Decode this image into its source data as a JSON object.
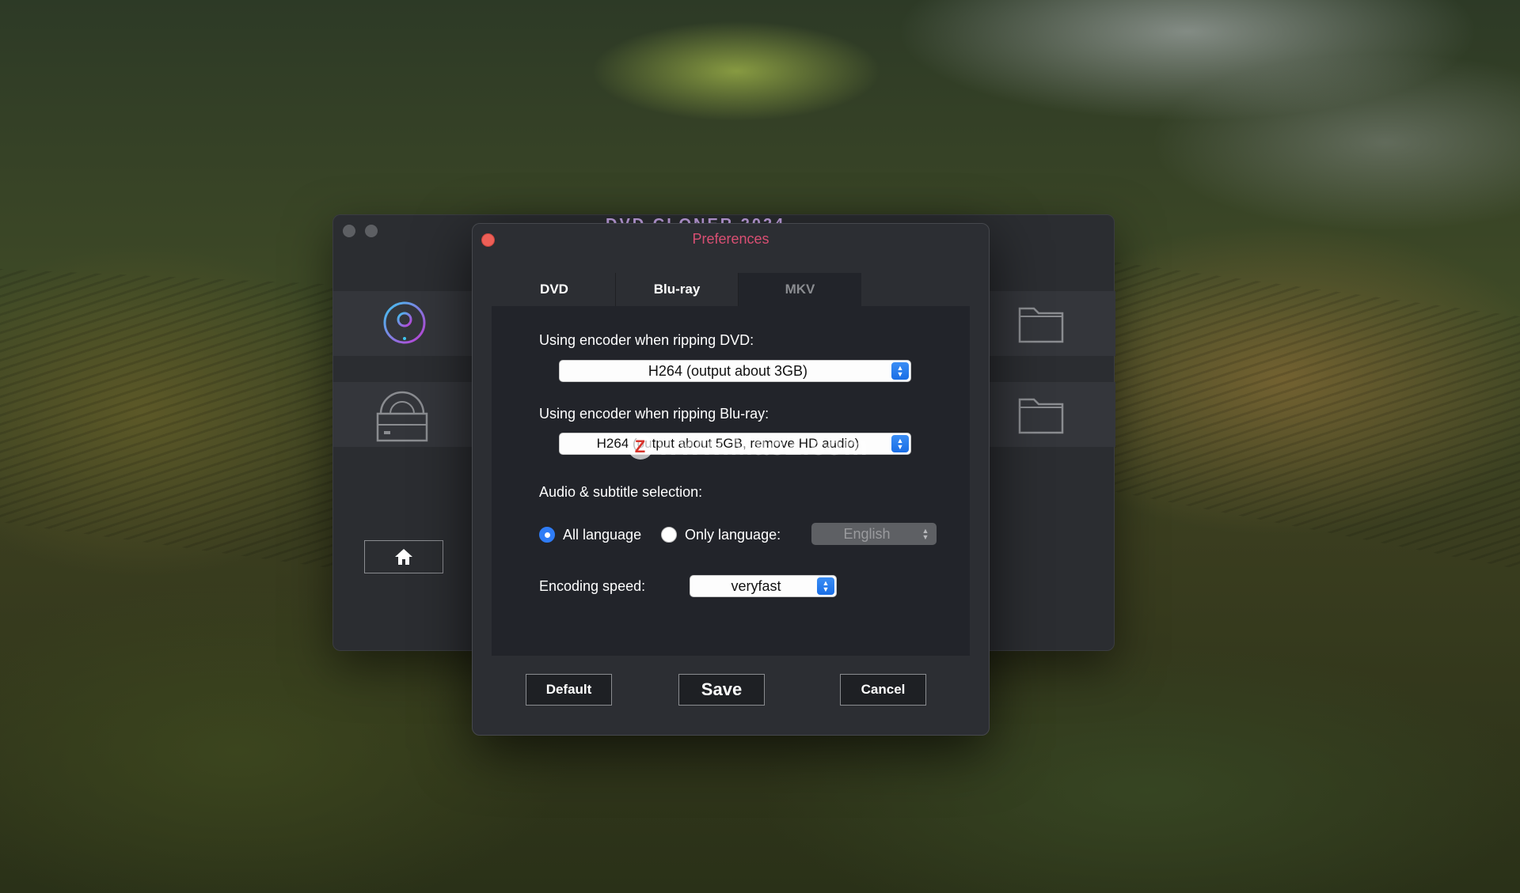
{
  "background_app": {
    "title": "DVD CLONER 2024"
  },
  "dialog": {
    "title": "Preferences",
    "tabs": [
      {
        "label": "DVD"
      },
      {
        "label": "Blu-ray"
      },
      {
        "label": "MKV",
        "active": true
      }
    ],
    "dvd_encoder": {
      "label": "Using encoder when ripping DVD:",
      "value": "H264 (output about 3GB)"
    },
    "bluray_encoder": {
      "label": "Using encoder when ripping Blu-ray:",
      "value": "H264 (output about 5GB, remove HD audio)"
    },
    "audio_subtitle": {
      "label": "Audio & subtitle selection:",
      "all_language": "All language",
      "only_language": "Only language:",
      "selected": "all_language",
      "language_value": "English"
    },
    "encoding_speed": {
      "label": "Encoding speed:",
      "value": "veryfast"
    },
    "buttons": {
      "default": "Default",
      "save": "Save",
      "cancel": "Cancel"
    },
    "watermark": "www.MacZ.com"
  },
  "colors": {
    "accent": "#2f7cf6",
    "title": "#d94f73",
    "close": "#ed5f57"
  }
}
